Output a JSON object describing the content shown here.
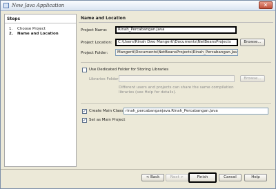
{
  "window": {
    "title": "New Java Application",
    "close_glyph": "✕"
  },
  "steps": {
    "heading": "Steps",
    "items": [
      {
        "num": "1.",
        "label": "Choose Project"
      },
      {
        "num": "2.",
        "label": "Name and Location"
      }
    ]
  },
  "main": {
    "heading": "Name and Location",
    "project_name": {
      "label": "Project Name:",
      "value": "Rinah_Percabangan.Java"
    },
    "project_location": {
      "label": "Project Location:",
      "value": "C:\\Users\\Rinah Dwo Mangerti\\Documents\\NetBeansProjects",
      "browse": "Browse..."
    },
    "project_folder": {
      "label": "Project Folder:",
      "value": "Mangerti\\Documents\\NetBeansProjects\\Rinah_Percabangan.Java"
    },
    "dedicated_folder": {
      "label": "Use Dedicated Folder for Storing Libraries",
      "checked": false
    },
    "libraries_folder": {
      "label": "Libraries Folder:",
      "value": "",
      "browse": "Browse..."
    },
    "libraries_help": [
      "Different users and projects can share the same compilation",
      "libraries (see Help for details)."
    ],
    "main_class": {
      "label": "Create Main Class",
      "checked": true,
      "value": "rinah_percabanganjava.Rinah_Percabangan.Java"
    },
    "set_main": {
      "label": "Set as Main Project",
      "checked": true
    },
    "check_glyph": "✓"
  },
  "buttons": {
    "back": "< Back",
    "next": "Next >",
    "finish": "Finish",
    "cancel": "Cancel",
    "help": "Help"
  },
  "icons": [
    "netbeans-app-icon",
    "close-icon",
    "checkbox-checked-icon"
  ]
}
